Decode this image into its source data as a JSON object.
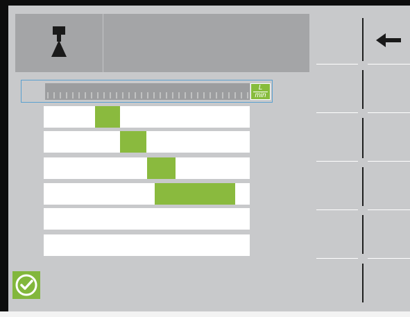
{
  "header": {
    "title": "",
    "icon": "boom-section-nozzle-icon"
  },
  "softkeys": {
    "back_icon": "arrow-left-icon"
  },
  "flow_bar": {
    "unit_numerator": "L",
    "unit_denominator": "min",
    "unit_color": "#87bc3c"
  },
  "sections": [
    {
      "name": "section-1",
      "fill_from": 0.25,
      "fill_to": 0.37
    },
    {
      "name": "section-2",
      "fill_from": 0.37,
      "fill_to": 0.5
    },
    {
      "name": "section-3",
      "fill_from": 0.5,
      "fill_to": 0.64
    },
    {
      "name": "section-4",
      "fill_from": 0.54,
      "fill_to": 0.93
    },
    {
      "name": "section-5",
      "fill_from": 0,
      "fill_to": 0
    },
    {
      "name": "section-6",
      "fill_from": 0,
      "fill_to": 0
    }
  ],
  "ok_icon": "checkmark-circle-icon",
  "colors": {
    "active_section": "#8aba3e",
    "background": "#c8c9cb",
    "header": "#a4a5a7",
    "selection_border": "#5aa0cf"
  }
}
